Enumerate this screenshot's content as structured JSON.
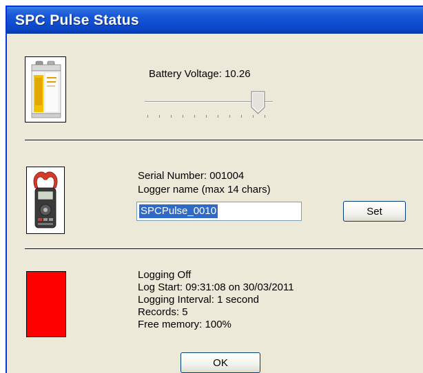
{
  "window": {
    "title": "SPC Pulse Status"
  },
  "battery": {
    "icon": "battery-icon",
    "voltage_label": "Battery Voltage: 10.26",
    "slider_value": 0.85,
    "tick_count": 11
  },
  "logger": {
    "icon": "clamp-meter-icon",
    "serial_label": "Serial Number: 001004",
    "name_label": "Logger name (max 14 chars)",
    "name_value": "SPCPulse_0010",
    "set_button_label": "Set"
  },
  "logging": {
    "status_color": "#ff0000",
    "lines": [
      "Logging Off",
      "Log Start: 09:31:08 on 30/03/2011",
      "Logging Interval: 1 second",
      "Records: 5",
      "Free memory: 100%"
    ]
  },
  "ok_button_label": "OK"
}
